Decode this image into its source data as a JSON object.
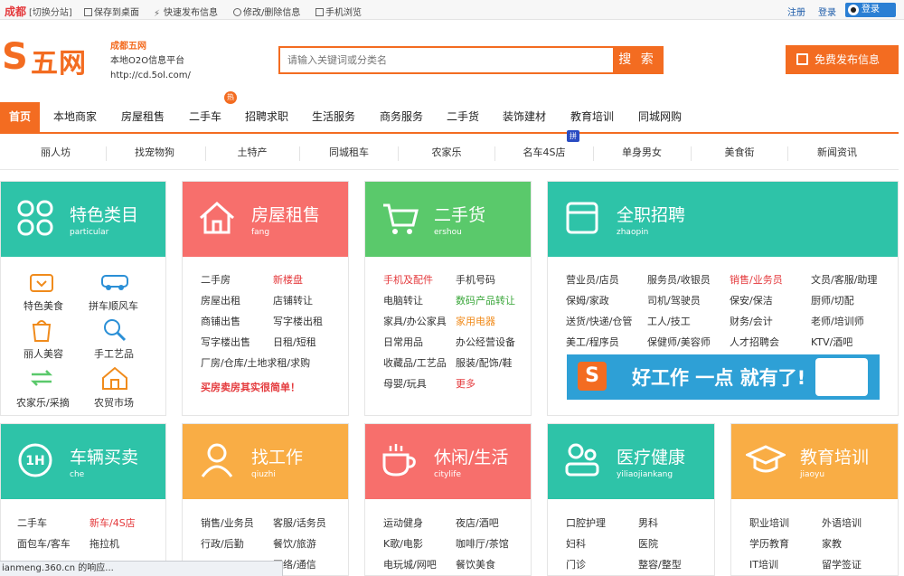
{
  "topbar": {
    "city": "成都",
    "switch": "[切换分站]",
    "save": "保存到桌面",
    "quickpub": "快速发布信息",
    "modify": "修改/删除信息",
    "mobile": "手机浏览",
    "register": "注册",
    "login": "登录",
    "qqlogin": "登录"
  },
  "logo": {
    "s": "S",
    "wu": "五网"
  },
  "slogan": {
    "title": "成都五网",
    "line2": "本地O2O信息平台",
    "url": "http://cd.5ol.com/"
  },
  "search": {
    "placeholder": "请输入关键词或分类名",
    "button": "搜 索"
  },
  "publish_button": "免费发布信息",
  "nav": {
    "items": [
      "首页",
      "本地商家",
      "房屋租售",
      "二手车",
      "招聘求职",
      "生活服务",
      "商务服务",
      "二手货",
      "装饰建材",
      "教育培训",
      "同城网购"
    ],
    "hot": "热"
  },
  "subnav": {
    "items": [
      "丽人坊",
      "找宠物狗",
      "土特产",
      "同城租车",
      "农家乐",
      "名车4S店",
      "单身男女",
      "美食街",
      "新闻资讯"
    ],
    "pin": "拼"
  },
  "cards": {
    "tese": {
      "title": "特色类目",
      "sub": "particular",
      "color": "#2ec3a8",
      "items": [
        "特色美食",
        "拼车顺风车",
        "丽人美容",
        "手工艺品",
        "农家乐/采摘",
        "农贸市场"
      ]
    },
    "fangwu": {
      "title": "房屋租售",
      "sub": "fang",
      "color": "#f76f6c",
      "items": [
        "二手房",
        "新楼盘",
        "房屋出租",
        "店铺转让",
        "商铺出售",
        "写字楼出租",
        "写字楼出售",
        "日租/短租",
        "厂房/仓库/土地求租/求购",
        "买房卖房其实很简单！"
      ]
    },
    "ershou": {
      "title": "二手货",
      "sub": "ershou",
      "color": "#5ac96b",
      "items": [
        "手机及配件",
        "手机号码",
        "电脑转让",
        "数码产品转让",
        "家具/办公家具",
        "家用电器",
        "日常用品",
        "办公经营设备",
        "收藏品/工艺品",
        "服装/配饰/鞋",
        "母婴/玩具",
        "更多"
      ]
    },
    "zhaopin": {
      "title": "全职招聘",
      "sub": "zhaopin",
      "color": "#2ec3a8",
      "items": [
        "营业员/店员",
        "服务员/收银员",
        "销售/业务员",
        "文员/客服/助理",
        "保姆/家政",
        "司机/驾驶员",
        "保安/保洁",
        "厨师/切配",
        "送货/快递/仓管",
        "工人/技工",
        "财务/会计",
        "老师/培训师",
        "美工/程序员",
        "保健师/美容师",
        "人才招聘会",
        "KTV/酒吧"
      ],
      "banner": "好工作 一点 就有了!"
    },
    "cheliang": {
      "title": "车辆买卖",
      "sub": "che",
      "color": "#2ec3a8",
      "items": [
        "二手车",
        "新车/4S店",
        "面包车/客车",
        "拖拉机"
      ]
    },
    "zhaogongzuo": {
      "title": "找工作",
      "sub": "qiuzhi",
      "color": "#f9ad45",
      "items": [
        "销售/业务员",
        "客服/话务员",
        "行政/后勤",
        "餐饮/旅游",
        "",
        "网络/通信"
      ]
    },
    "xiuxian": {
      "title": "休闲/生活",
      "sub": "citylife",
      "color": "#f76f6c",
      "items": [
        "运动健身",
        "夜店/酒吧",
        "K歌/电影",
        "咖啡厅/茶馆",
        "电玩城/网吧",
        "餐饮美食"
      ]
    },
    "yiliao": {
      "title": "医疗健康",
      "sub": "yiliaojiankang",
      "color": "#2ec3a8",
      "items": [
        "口腔护理",
        "男科",
        "妇科",
        "医院",
        "门诊",
        "整容/整型"
      ]
    },
    "jiaoyu": {
      "title": "教育培训",
      "sub": "jiaoyu",
      "color": "#f9ad45",
      "items": [
        "职业培训",
        "外语培训",
        "学历教育",
        "家教",
        "IT培训",
        "留学签证"
      ]
    }
  },
  "status": "ianmeng.360.cn 的响应..."
}
